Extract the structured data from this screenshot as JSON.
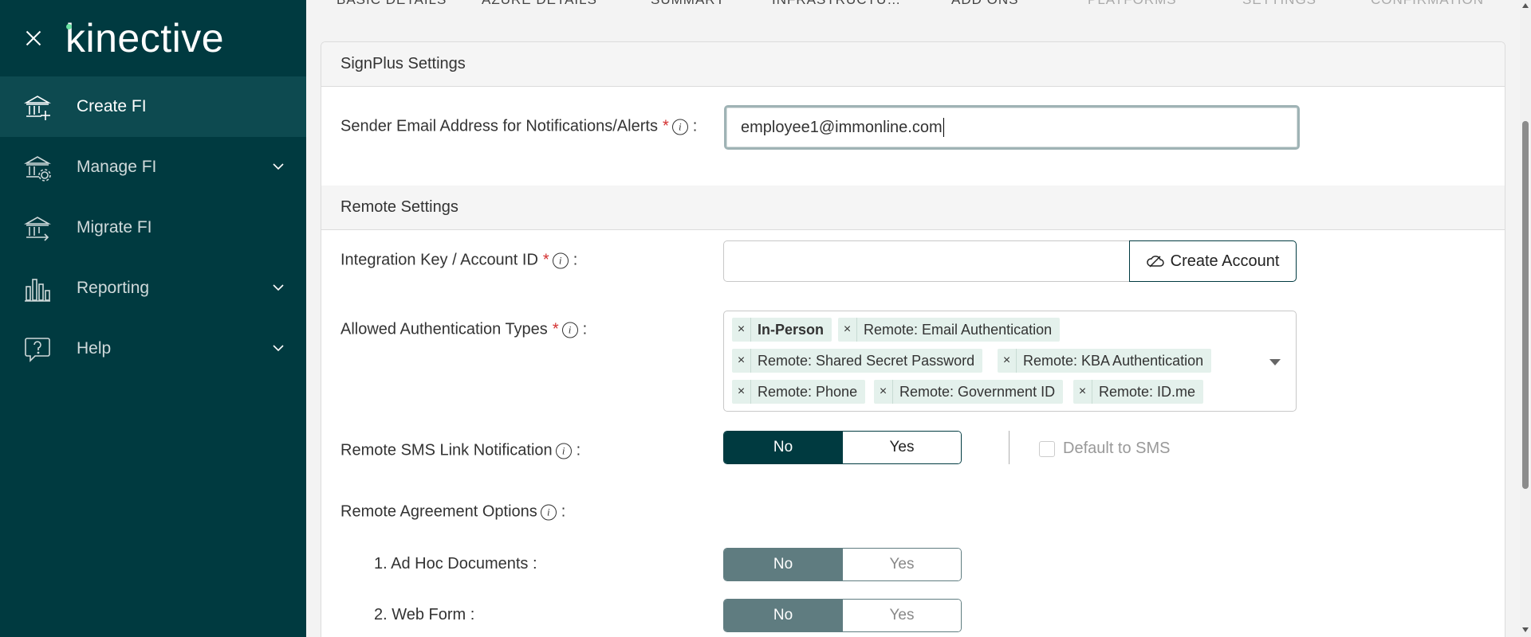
{
  "sidebar": {
    "logo": "kinective",
    "items": [
      {
        "label": "Create FI",
        "icon": "bank-add-icon",
        "active": true
      },
      {
        "label": "Manage FI",
        "icon": "bank-gear-icon",
        "expandable": true
      },
      {
        "label": "Migrate FI",
        "icon": "bank-arrow-icon"
      },
      {
        "label": "Reporting",
        "icon": "bar-chart-icon",
        "expandable": true
      },
      {
        "label": "Help",
        "icon": "help-bubble-icon",
        "expandable": true
      }
    ]
  },
  "steps": [
    "BASIC DETAILS",
    "AZURE DETAILS",
    "SUMMARY",
    "INFRASTRUCTU…",
    "ADD ONS",
    "PLATFORMS",
    "SETTINGS",
    "CONFIRMATION"
  ],
  "signplus": {
    "heading": "SignPlus Settings",
    "sender_email_label": "Sender Email Address for Notifications/Alerts",
    "sender_email_value": "employee1@immonline.com"
  },
  "remote": {
    "heading": "Remote Settings",
    "integration_key_label": "Integration Key / Account ID",
    "integration_key_value": "",
    "create_account_label": "Create Account",
    "auth_types_label": "Allowed Authentication Types",
    "auth_types": [
      "In-Person",
      "Remote: Email Authentication",
      "Remote: Shared Secret Password",
      "Remote: KBA Authentication",
      "Remote: Phone",
      "Remote: Government ID",
      "Remote: ID.me"
    ],
    "sms_label": "Remote SMS Link Notification",
    "no_label": "No",
    "yes_label": "Yes",
    "default_sms_label": "Default to SMS",
    "agreement_label": "Remote Agreement Options",
    "adhoc_label": "1. Ad Hoc Documents :",
    "webform_label": "2. Web Form :"
  },
  "colors": {
    "sidebar_bg": "#003a40",
    "accent": "#003a40",
    "chip_bg": "#e4f1ec",
    "required": "#d32f2f"
  }
}
